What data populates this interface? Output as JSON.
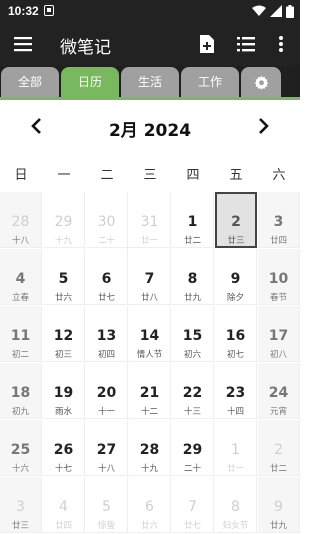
{
  "status_bar": {
    "time": "10:32"
  },
  "app": {
    "title": "微笔记"
  },
  "tabs": [
    {
      "label": "全部"
    },
    {
      "label": "日历"
    },
    {
      "label": "生活"
    },
    {
      "label": "工作"
    }
  ],
  "active_tab": 1,
  "calendar": {
    "month_title": "2月 2024",
    "weekdays": [
      "日",
      "一",
      "二",
      "三",
      "四",
      "五",
      "六"
    ],
    "today_index": 5,
    "cells": [
      {
        "day": "28",
        "lunar": "十八",
        "dim": true
      },
      {
        "day": "29",
        "lunar": "十九",
        "dim": true
      },
      {
        "day": "30",
        "lunar": "二十",
        "dim": true
      },
      {
        "day": "31",
        "lunar": "廿一",
        "dim": true
      },
      {
        "day": "1",
        "lunar": "廿二",
        "dim": false
      },
      {
        "day": "2",
        "lunar": "廿三",
        "dim": false
      },
      {
        "day": "3",
        "lunar": "廿四",
        "dim": false
      },
      {
        "day": "4",
        "lunar": "立春",
        "dim": false
      },
      {
        "day": "5",
        "lunar": "廿六",
        "dim": false
      },
      {
        "day": "6",
        "lunar": "廿七",
        "dim": false
      },
      {
        "day": "7",
        "lunar": "廿八",
        "dim": false
      },
      {
        "day": "8",
        "lunar": "廿九",
        "dim": false
      },
      {
        "day": "9",
        "lunar": "除夕",
        "dim": false
      },
      {
        "day": "10",
        "lunar": "春节",
        "dim": false
      },
      {
        "day": "11",
        "lunar": "初二",
        "dim": false
      },
      {
        "day": "12",
        "lunar": "初三",
        "dim": false
      },
      {
        "day": "13",
        "lunar": "初四",
        "dim": false
      },
      {
        "day": "14",
        "lunar": "情人节",
        "dim": false
      },
      {
        "day": "15",
        "lunar": "初六",
        "dim": false
      },
      {
        "day": "16",
        "lunar": "初七",
        "dim": false
      },
      {
        "day": "17",
        "lunar": "初八",
        "dim": false
      },
      {
        "day": "18",
        "lunar": "初九",
        "dim": false
      },
      {
        "day": "19",
        "lunar": "雨水",
        "dim": false
      },
      {
        "day": "20",
        "lunar": "十一",
        "dim": false
      },
      {
        "day": "21",
        "lunar": "十二",
        "dim": false
      },
      {
        "day": "22",
        "lunar": "十三",
        "dim": false
      },
      {
        "day": "23",
        "lunar": "十四",
        "dim": false
      },
      {
        "day": "24",
        "lunar": "元宵",
        "dim": false
      },
      {
        "day": "25",
        "lunar": "十六",
        "dim": false
      },
      {
        "day": "26",
        "lunar": "十七",
        "dim": false
      },
      {
        "day": "27",
        "lunar": "十八",
        "dim": false
      },
      {
        "day": "28",
        "lunar": "十九",
        "dim": false
      },
      {
        "day": "29",
        "lunar": "二十",
        "dim": false
      },
      {
        "day": "1",
        "lunar": "廿一",
        "dim": true
      },
      {
        "day": "2",
        "lunar": "廿二",
        "dim": true
      },
      {
        "day": "3",
        "lunar": "廿三",
        "dim": true
      },
      {
        "day": "4",
        "lunar": "廿四",
        "dim": true
      },
      {
        "day": "5",
        "lunar": "惊蛰",
        "dim": true
      },
      {
        "day": "6",
        "lunar": "廿六",
        "dim": true
      },
      {
        "day": "7",
        "lunar": "廿七",
        "dim": true
      },
      {
        "day": "8",
        "lunar": "妇女节",
        "dim": true
      },
      {
        "day": "9",
        "lunar": "廿九",
        "dim": true
      }
    ]
  },
  "colors": {
    "bar_background": "#222222",
    "accent_green": "#78b85f",
    "inactive_tab": "#a0a0a0",
    "today_highlight": "#e2e2e2"
  },
  "icons": [
    "menu-icon",
    "add-note-icon",
    "list-icon",
    "more-vertical-icon",
    "settings-gear-icon",
    "chevron-left-icon",
    "chevron-right-icon"
  ]
}
